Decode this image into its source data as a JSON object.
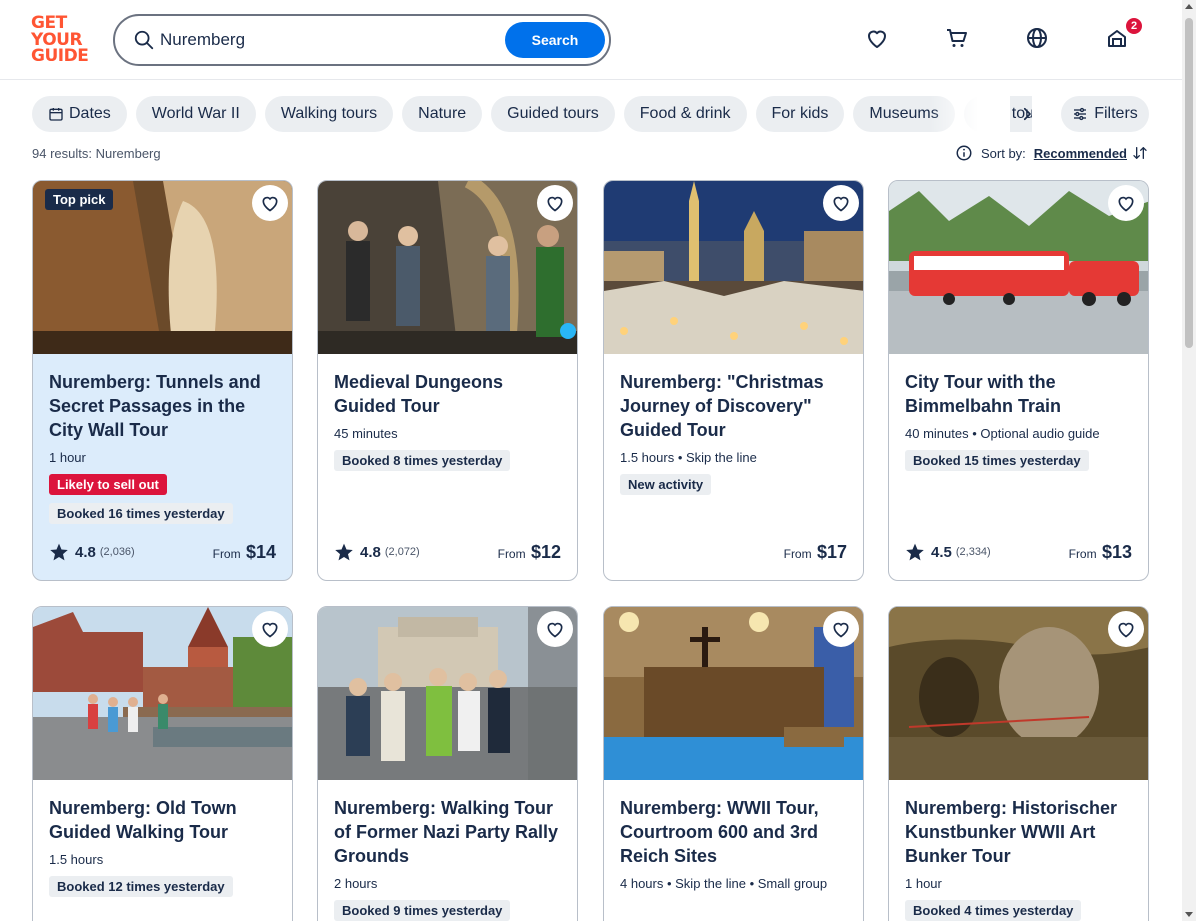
{
  "brand": {
    "logo_lines": [
      "GET",
      "YOUR",
      "GUIDE"
    ],
    "color": "#ff5533"
  },
  "search": {
    "value": "Nuremberg",
    "button": "Search"
  },
  "header": {
    "cart_badge": "2"
  },
  "filters": {
    "chips": [
      "Dates",
      "World War II",
      "Walking tours",
      "Nature",
      "Guided tours",
      "Food & drink",
      "For kids",
      "Museums",
      "Bus tours"
    ],
    "filters_label": "Filters"
  },
  "results": {
    "count_text": "94 results: Nuremberg",
    "sort_label": "Sort by:",
    "sort_value": "Recommended"
  },
  "cards": [
    {
      "title": "Nuremberg: Tunnels and Secret Passages in the City Wall Tour",
      "badge": "Top pick",
      "meta": "1 hour",
      "alert": "Likely to sell out",
      "booked": "Booked 16 times yesterday",
      "rating": "4.8",
      "reviews": "(2,036)",
      "from": "From",
      "price": "$14"
    },
    {
      "title": "Medieval Dungeons Guided Tour",
      "meta": "45 minutes",
      "booked": "Booked 8 times yesterday",
      "rating": "4.8",
      "reviews": "(2,072)",
      "from": "From",
      "price": "$12"
    },
    {
      "title": "Nuremberg: \"Christmas Journey of Discovery\" Guided Tour",
      "meta": "1.5 hours • Skip the line",
      "booked": "New activity",
      "from": "From",
      "price": "$17"
    },
    {
      "title": "City Tour with the Bimmelbahn Train",
      "meta": "40 minutes • Optional audio guide",
      "booked": "Booked 15 times yesterday",
      "rating": "4.5",
      "reviews": "(2,334)",
      "from": "From",
      "price": "$13"
    },
    {
      "title": "Nuremberg: Old Town Guided Walking Tour",
      "meta": "1.5 hours",
      "booked": "Booked 12 times yesterday"
    },
    {
      "title": "Nuremberg: Walking Tour of Former Nazi Party Rally Grounds",
      "meta": "2 hours",
      "booked": "Booked 9 times yesterday"
    },
    {
      "title": "Nuremberg: WWII Tour, Courtroom 600 and 3rd Reich Sites",
      "meta": "4 hours • Skip the line • Small group"
    },
    {
      "title": "Nuremberg: Historischer Kunstbunker WWII Art Bunker Tour",
      "meta": "1 hour",
      "booked": "Booked 4 times yesterday"
    }
  ]
}
